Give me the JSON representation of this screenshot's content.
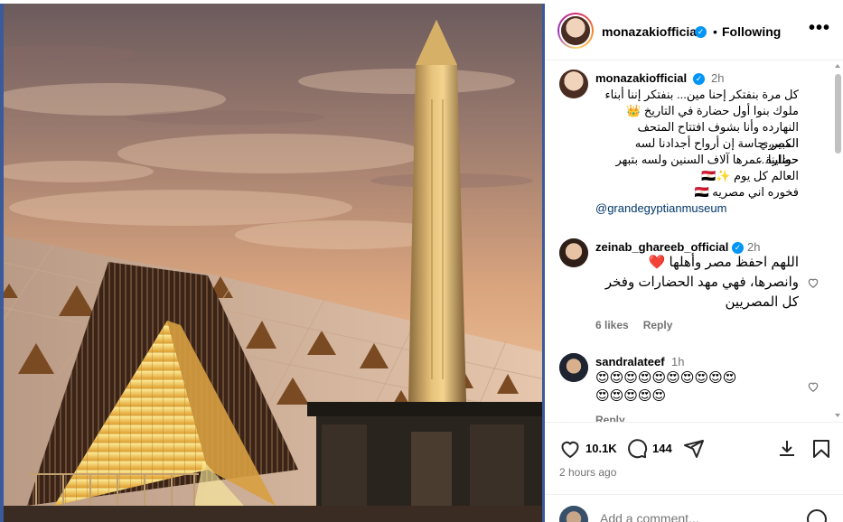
{
  "post": {
    "username": "monazakiofficial",
    "verified": true,
    "follow_state": "Following",
    "separator": "•",
    "more_label": "•••"
  },
  "caption": {
    "username": "monazakiofficial",
    "time": "2h",
    "lines": [
      "كل مرة بنفتكر إحنا مين... بنفتكر إننا أبناء",
      "ملوك بنوا أول حضارة في التاريخ 👑",
      "النهارده وأنا بشوف افتتاح المتحف المصري",
      "الكبير، حاسة إن أرواح أجدادنا لسه حوالينا...",
      "حضارة عمرها آلاف السنين ولسه بتبهر",
      "العالم كل يوم ✨🇪🇬",
      "فخوره اني مصريه 🇪🇬"
    ],
    "mention": "@grandegyptianmuseum"
  },
  "comments": [
    {
      "username": "zeinab_ghareeb_official",
      "verified": true,
      "time": "2h",
      "lines": [
        "اللهم احفظ مصر وأهلها ❤️",
        "وانصرها، فهي مهد الحضارات وفخر",
        "كل المصريين"
      ],
      "likes": "6 likes",
      "reply": "Reply"
    },
    {
      "username": "sandralateef",
      "verified": false,
      "time": "1h",
      "lines": [
        "😍😍😍😍😍😍😍😍😍😍",
        "😍😍😍😍😍"
      ],
      "reply": "Reply"
    }
  ],
  "actions": {
    "like_count": "10.1K",
    "comment_count": "144",
    "time_ago": "2 hours ago"
  },
  "add_comment": {
    "placeholder": "Add a comment..."
  },
  "icons": {
    "like": "heart-icon",
    "comment": "comment-icon",
    "share": "share-icon",
    "save": "save-icon",
    "emoji": "emoji-icon",
    "more": "more-icon",
    "verified": "verified-icon"
  },
  "colors": {
    "verified_blue": "#0095f6",
    "mention_blue": "#00376b",
    "muted_text": "#737373",
    "divider": "#efefef",
    "heart_red": "#ed4956"
  }
}
